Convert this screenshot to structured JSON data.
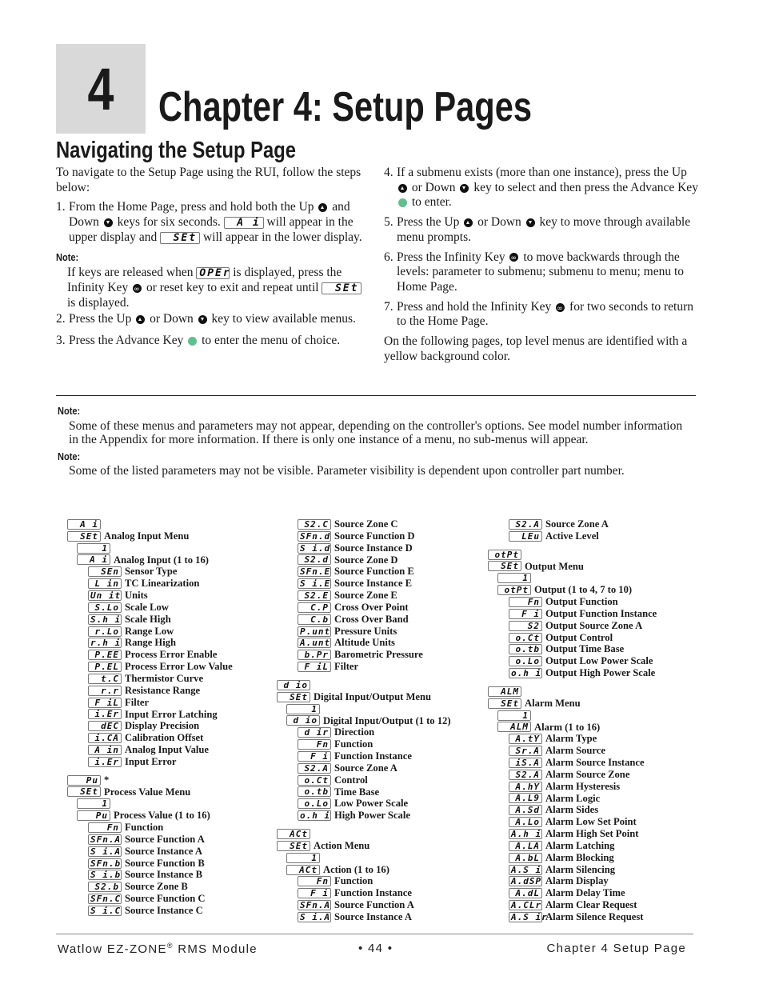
{
  "chapter": {
    "number": "4",
    "title": "Chapter 4: Setup Pages"
  },
  "section_title": "Navigating the Setup Page",
  "intro": "To navigate to the Setup Page using the RUI, follow the steps below:",
  "steps_left": {
    "s1": {
      "num": "1.",
      "a": "From the Home Page, press and hold both the Up",
      "b": "and Down",
      "c": "keys for six seconds.",
      "lcd1": "A i",
      "d": "will appear in the upper display and",
      "lcd2": "SEt",
      "e": "will appear in the lower display."
    },
    "note_label": "Note:",
    "note": {
      "a": "If keys are released when",
      "lcd1": "OPEr",
      "b": "is displayed, press the Infinity Key",
      "c": "or reset key to exit and repeat until",
      "lcd2": "SEt",
      "d": "is displayed."
    },
    "s2": {
      "num": "2.",
      "a": "Press the Up",
      "b": "or Down",
      "c": "key to view available menus."
    },
    "s3": {
      "num": "3.",
      "a": "Press the Advance Key",
      "b": "to enter the menu of choice."
    }
  },
  "steps_right": {
    "s4": {
      "num": "4.",
      "a": "If a submenu exists (more than one instance), press the Up",
      "b": "or Down",
      "c": "key to select and then press the Advance Key",
      "d": "to enter."
    },
    "s5": {
      "num": "5.",
      "a": "Press the Up",
      "b": "or Down",
      "c": "key to move through available menu prompts."
    },
    "s6": {
      "num": "6.",
      "a": "Press the Infinity Key",
      "b": "to move backwards through the levels: parameter to submenu; submenu to menu; menu to Home Page."
    },
    "s7": {
      "num": "7.",
      "a": "Press and hold the Infinity Key",
      "b": "for two seconds to return to the Home Page."
    },
    "closing": "On the following pages, top level menus are identified with a yellow background color."
  },
  "notes": [
    {
      "label": "Note:",
      "text": "Some of these menus and parameters may not appear, depending on the controller's options. See model number information in the Appendix for more information. If there is only one instance of a menu, no sub-menus will appear."
    },
    {
      "label": "Note:",
      "text": "Some of the listed parameters may not be visible. Parameter visibility is dependent upon controller part number."
    }
  ],
  "menu_columns": [
    [
      {
        "lvl": 0,
        "code": "A i",
        "label": ""
      },
      {
        "lvl": 0,
        "code": "SEt",
        "label": "Analog Input Menu"
      },
      {
        "lvl": 1,
        "code": "1",
        "label": ""
      },
      {
        "lvl": 1,
        "code": "A i",
        "label": "Analog Input (1 to 16)"
      },
      {
        "lvl": 2,
        "code": "SEn",
        "label": "Sensor Type"
      },
      {
        "lvl": 2,
        "code": "L in",
        "label": "TC Linearization"
      },
      {
        "lvl": 2,
        "code": "Un it",
        "label": "Units"
      },
      {
        "lvl": 2,
        "code": "S.Lo",
        "label": "Scale Low"
      },
      {
        "lvl": 2,
        "code": "S.h i",
        "label": "Scale High"
      },
      {
        "lvl": 2,
        "code": "r.Lo",
        "label": "Range Low"
      },
      {
        "lvl": 2,
        "code": "r.h i",
        "label": "Range High"
      },
      {
        "lvl": 2,
        "code": "P.EE",
        "label": "Process Error Enable"
      },
      {
        "lvl": 2,
        "code": "P.EL",
        "label": "Process Error Low Value"
      },
      {
        "lvl": 2,
        "code": "t.C",
        "label": "Thermistor Curve"
      },
      {
        "lvl": 2,
        "code": "r.r",
        "label": "Resistance Range"
      },
      {
        "lvl": 2,
        "code": "F iL",
        "label": "Filter"
      },
      {
        "lvl": 2,
        "code": "i.Er",
        "label": "Input Error Latching"
      },
      {
        "lvl": 2,
        "code": "dEC",
        "label": "Display Precision"
      },
      {
        "lvl": 2,
        "code": "i.CA",
        "label": "Calibration Offset"
      },
      {
        "lvl": 2,
        "code": "A in",
        "label": "Analog Input Value"
      },
      {
        "lvl": 2,
        "code": "i.Er",
        "label": "Input Error"
      },
      {
        "gap": true
      },
      {
        "lvl": 0,
        "code": "Pu",
        "label": "*"
      },
      {
        "lvl": 0,
        "code": "SEt",
        "label": "Process Value Menu"
      },
      {
        "lvl": 1,
        "code": "1",
        "label": ""
      },
      {
        "lvl": 1,
        "code": "Pu",
        "label": "Process Value (1 to 16)"
      },
      {
        "lvl": 2,
        "code": "Fn",
        "label": "Function"
      },
      {
        "lvl": 2,
        "code": "SFn.A",
        "label": "Source Function A"
      },
      {
        "lvl": 2,
        "code": "S i.A",
        "label": "Source Instance A"
      },
      {
        "lvl": 2,
        "code": "SFn.b",
        "label": "Source Function B"
      },
      {
        "lvl": 2,
        "code": "S i.b",
        "label": "Source Instance B"
      },
      {
        "lvl": 2,
        "code": "S2.b",
        "label": "Source Zone B"
      },
      {
        "lvl": 2,
        "code": "SFn.C",
        "label": "Source Function C"
      },
      {
        "lvl": 2,
        "code": "S i.C",
        "label": "Source Instance C"
      }
    ],
    [
      {
        "lvl": 2,
        "code": "S2.C",
        "label": "Source Zone C"
      },
      {
        "lvl": 2,
        "code": "SFn.d",
        "label": "Source Function D"
      },
      {
        "lvl": 2,
        "code": "S i.d",
        "label": "Source Instance D"
      },
      {
        "lvl": 2,
        "code": "S2.d",
        "label": "Source Zone D"
      },
      {
        "lvl": 2,
        "code": "SFn.E",
        "label": "Source Function E"
      },
      {
        "lvl": 2,
        "code": "S i.E",
        "label": "Source Instance E"
      },
      {
        "lvl": 2,
        "code": "S2.E",
        "label": "Source Zone E"
      },
      {
        "lvl": 2,
        "code": "C.P",
        "label": "Cross Over Point"
      },
      {
        "lvl": 2,
        "code": "C.b",
        "label": "Cross Over Band"
      },
      {
        "lvl": 2,
        "code": "P.unt",
        "label": "Pressure Units"
      },
      {
        "lvl": 2,
        "code": "A.unt",
        "label": "Altitude Units"
      },
      {
        "lvl": 2,
        "code": "b.Pr",
        "label": "Barometric Pressure"
      },
      {
        "lvl": 2,
        "code": "F iL",
        "label": "Filter"
      },
      {
        "gap": true
      },
      {
        "lvl": 0,
        "code": "d io",
        "label": ""
      },
      {
        "lvl": 0,
        "code": "SEt",
        "label": "Digital Input/Output Menu"
      },
      {
        "lvl": 1,
        "code": "1",
        "label": ""
      },
      {
        "lvl": 1,
        "code": "d io",
        "label": "Digital Input/Output (1 to 12)"
      },
      {
        "lvl": 2,
        "code": "d ir",
        "label": "Direction"
      },
      {
        "lvl": 2,
        "code": "Fn",
        "label": "Function"
      },
      {
        "lvl": 2,
        "code": "F i",
        "label": "Function Instance"
      },
      {
        "lvl": 2,
        "code": "S2.A",
        "label": "Source Zone A"
      },
      {
        "lvl": 2,
        "code": "o.Ct",
        "label": "Control"
      },
      {
        "lvl": 2,
        "code": "o.tb",
        "label": "Time Base"
      },
      {
        "lvl": 2,
        "code": "o.Lo",
        "label": "Low Power Scale"
      },
      {
        "lvl": 2,
        "code": "o.h i",
        "label": "High Power Scale"
      },
      {
        "gap": true
      },
      {
        "lvl": 0,
        "code": "ACt",
        "label": ""
      },
      {
        "lvl": 0,
        "code": "SEt",
        "label": "Action Menu"
      },
      {
        "lvl": 1,
        "code": "1",
        "label": ""
      },
      {
        "lvl": 1,
        "code": "ACt",
        "label": "Action (1 to 16)"
      },
      {
        "lvl": 2,
        "code": "Fn",
        "label": "Function"
      },
      {
        "lvl": 2,
        "code": "F i",
        "label": "Function Instance"
      },
      {
        "lvl": 2,
        "code": "SFn.A",
        "label": "Source Function A"
      },
      {
        "lvl": 2,
        "code": "S i.A",
        "label": "Source Instance A"
      }
    ],
    [
      {
        "lvl": 2,
        "code": "S2.A",
        "label": "Source Zone A"
      },
      {
        "lvl": 2,
        "code": "LEu",
        "label": "Active Level"
      },
      {
        "gap": true
      },
      {
        "lvl": 0,
        "code": "otPt",
        "label": ""
      },
      {
        "lvl": 0,
        "code": "SEt",
        "label": "Output Menu"
      },
      {
        "lvl": 1,
        "code": "1",
        "label": ""
      },
      {
        "lvl": 1,
        "code": "otPt",
        "label": "Output (1 to 4, 7 to 10)"
      },
      {
        "lvl": 2,
        "code": "Fn",
        "label": "Output Function"
      },
      {
        "lvl": 2,
        "code": "F i",
        "label": "Output Function Instance"
      },
      {
        "lvl": 2,
        "code": "S2",
        "label": "Output Source Zone A"
      },
      {
        "lvl": 2,
        "code": "o.Ct",
        "label": "Output Control"
      },
      {
        "lvl": 2,
        "code": "o.tb",
        "label": "Output Time Base"
      },
      {
        "lvl": 2,
        "code": "o.Lo",
        "label": "Output Low Power Scale"
      },
      {
        "lvl": 2,
        "code": "o.h i",
        "label": "Output High Power Scale"
      },
      {
        "gap": true
      },
      {
        "lvl": 0,
        "code": "ALM",
        "label": ""
      },
      {
        "lvl": 0,
        "code": "SEt",
        "label": "Alarm Menu"
      },
      {
        "lvl": 1,
        "code": "1",
        "label": ""
      },
      {
        "lvl": 1,
        "code": "ALM",
        "label": "Alarm (1 to 16)"
      },
      {
        "lvl": 2,
        "code": "A.tY",
        "label": "Alarm Type"
      },
      {
        "lvl": 2,
        "code": "Sr.A",
        "label": "Alarm Source"
      },
      {
        "lvl": 2,
        "code": "iS.A",
        "label": "Alarm Source Instance"
      },
      {
        "lvl": 2,
        "code": "S2.A",
        "label": "Alarm Source Zone"
      },
      {
        "lvl": 2,
        "code": "A.hY",
        "label": "Alarm Hysteresis"
      },
      {
        "lvl": 2,
        "code": "A.L9",
        "label": "Alarm Logic"
      },
      {
        "lvl": 2,
        "code": "A.Sd",
        "label": "Alarm Sides"
      },
      {
        "lvl": 2,
        "code": "A.Lo",
        "label": "Alarm Low Set Point"
      },
      {
        "lvl": 2,
        "code": "A.h i",
        "label": "Alarm High Set Point"
      },
      {
        "lvl": 2,
        "code": "A.LA",
        "label": "Alarm Latching"
      },
      {
        "lvl": 2,
        "code": "A.bL",
        "label": "Alarm Blocking"
      },
      {
        "lvl": 2,
        "code": "A.S i",
        "label": "Alarm Silencing"
      },
      {
        "lvl": 2,
        "code": "A.dSP",
        "label": "Alarm Display"
      },
      {
        "lvl": 2,
        "code": "A.dL",
        "label": "Alarm Delay Time"
      },
      {
        "lvl": 2,
        "code": "A.CLr",
        "label": "Alarm Clear Request"
      },
      {
        "lvl": 2,
        "code": "A.S ir",
        "label": "Alarm Silence Request"
      }
    ]
  ],
  "footer": {
    "left": "Watlow EZ-ZONE",
    "reg": "®",
    "left2": " RMS Module",
    "center": "•  44  •",
    "right": "Chapter 4 Setup Page"
  }
}
